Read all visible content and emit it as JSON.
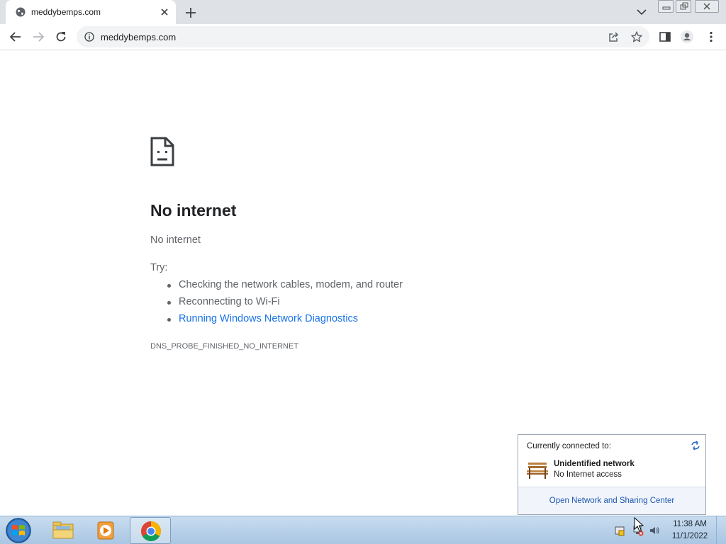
{
  "browser": {
    "tab": {
      "title": "meddybemps.com"
    },
    "address_bar": {
      "url": "meddybemps.com"
    }
  },
  "error_page": {
    "title": "No internet",
    "subtitle": "No internet",
    "try_label": "Try:",
    "suggestions": [
      "Checking the network cables, modem, and router",
      "Reconnecting to Wi-Fi",
      "Running Windows Network Diagnostics"
    ],
    "error_code": "DNS_PROBE_FINISHED_NO_INTERNET"
  },
  "network_flyout": {
    "label": "Currently connected to:",
    "network_name": "Unidentified network",
    "status": "No Internet access",
    "link": "Open Network and Sharing Center"
  },
  "taskbar": {
    "clock": {
      "time": "11:38 AM",
      "date": "11/1/2022"
    },
    "apps": [
      "windows-explorer",
      "media-player",
      "chrome"
    ]
  },
  "colors": {
    "link": "#1a73e8",
    "tab_strip": "#dee1e6",
    "text_secondary": "#5f6368",
    "taskbar": "#a9c6e2"
  }
}
